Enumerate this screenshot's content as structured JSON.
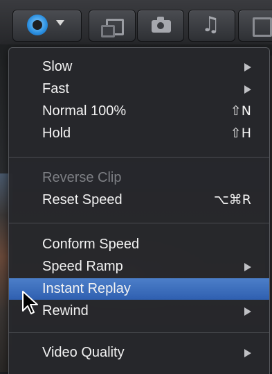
{
  "toolbar": {
    "buttons": [
      {
        "name": "retime-menu",
        "icon": "retime-icon",
        "has_dropdown": true
      },
      {
        "name": "clip",
        "icon": "clip-icon"
      },
      {
        "name": "camera",
        "icon": "camera-icon"
      },
      {
        "name": "music",
        "icon": "music-note-icon",
        "glyph": "♫"
      },
      {
        "name": "more",
        "icon": "generator-icon"
      }
    ]
  },
  "menu": {
    "items": [
      {
        "label": "Slow",
        "submenu": true
      },
      {
        "label": "Fast",
        "submenu": true
      },
      {
        "label": "Normal 100%",
        "shortcut": "⇧N"
      },
      {
        "label": "Hold",
        "shortcut": "⇧H"
      },
      {
        "label": "Reverse Clip",
        "disabled": true
      },
      {
        "label": "Reset Speed",
        "shortcut": "⌥⌘R"
      },
      {
        "label": "Conform Speed"
      },
      {
        "label": "Speed Ramp",
        "submenu": true
      },
      {
        "label": "Instant Replay",
        "selected": true
      },
      {
        "label": "Rewind",
        "submenu": true
      },
      {
        "label": "Video Quality",
        "submenu": true
      }
    ]
  },
  "colors": {
    "menu_bg": "#26282c",
    "selection": "#2f5fb0",
    "text": "#f2f2f2",
    "disabled_text": "#7d7f84"
  }
}
